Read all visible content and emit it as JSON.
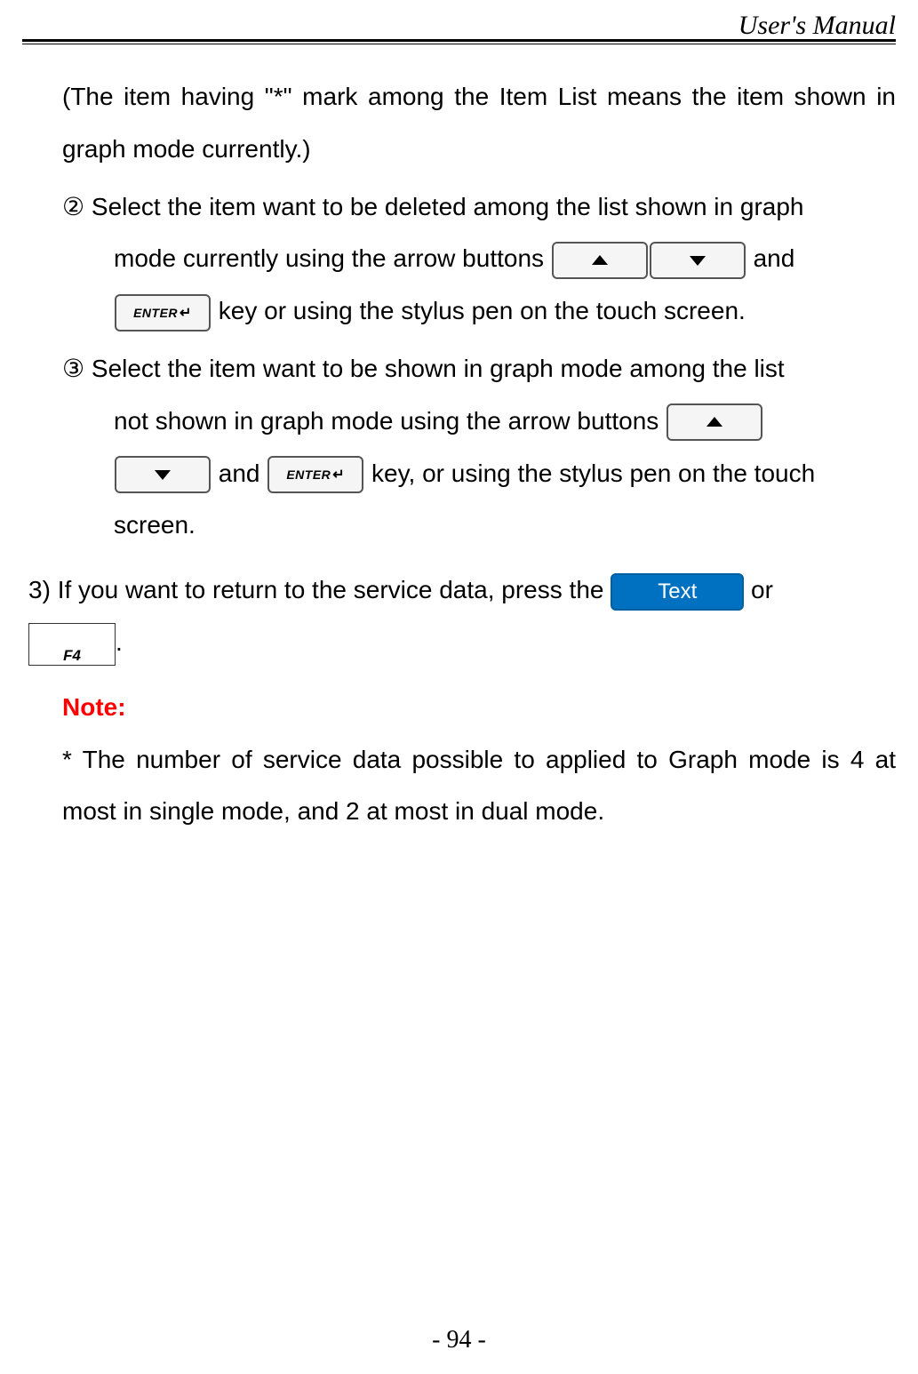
{
  "header": {
    "title": "User's Manual"
  },
  "body": {
    "intro": "(The item having \"*\" mark among the Item List means the item shown in graph mode currently.)",
    "step2_marker": "②",
    "step2_a": "Select the item want to be deleted among the list shown in graph",
    "step2_b_pre": "mode currently using the arrow buttons ",
    "step2_b_post": " and",
    "step2_c_post": " key or using the stylus pen on the touch screen.",
    "step3_marker": "③",
    "step3_a": "Select the item want to be shown in graph mode among the list",
    "step3_b_pre": "not shown in graph mode using the arrow buttons ",
    "step3_c_mid": " and ",
    "step3_c_post": " key, or using the stylus pen on the touch",
    "step3_d": "screen.",
    "item3_marker": "3)",
    "item3_a": "If you want to return to the service data, press the ",
    "item3_a_post": " or",
    "item3_b_post": ".",
    "note_label": "Note:",
    "note_text": "* The number of service data possible to applied to Graph mode is 4 at most in single mode, and 2 at most in dual mode."
  },
  "buttons": {
    "text_label": "Text",
    "f4_label": "F4"
  },
  "footer": {
    "page": "- 94 -"
  }
}
